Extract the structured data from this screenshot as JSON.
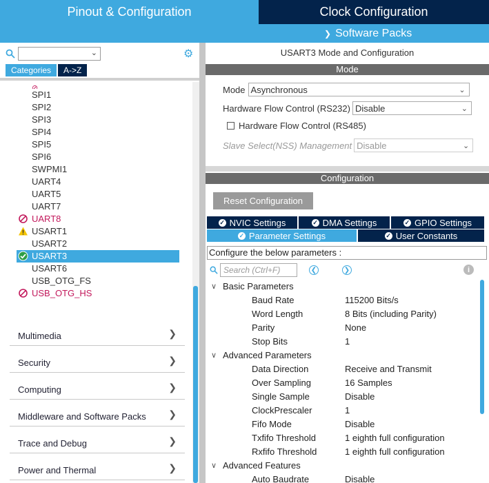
{
  "header": {
    "tab_pinout": "Pinout & Configuration",
    "tab_clock": "Clock Configuration",
    "software_packs": "Software Packs"
  },
  "sidebar": {
    "search_value": "",
    "tab_categories": "Categories",
    "tab_az": "A->Z",
    "peripherals": [
      {
        "label": "SPI1",
        "status": "none"
      },
      {
        "label": "SPI2",
        "status": "none"
      },
      {
        "label": "SPI3",
        "status": "none"
      },
      {
        "label": "SPI4",
        "status": "none"
      },
      {
        "label": "SPI5",
        "status": "none"
      },
      {
        "label": "SPI6",
        "status": "none"
      },
      {
        "label": "SWPMI1",
        "status": "none"
      },
      {
        "label": "UART4",
        "status": "none"
      },
      {
        "label": "UART5",
        "status": "none"
      },
      {
        "label": "UART7",
        "status": "none"
      },
      {
        "label": "UART8",
        "status": "disabled"
      },
      {
        "label": "USART1",
        "status": "warning"
      },
      {
        "label": "USART2",
        "status": "none"
      },
      {
        "label": "USART3",
        "status": "ok"
      },
      {
        "label": "USART6",
        "status": "none"
      },
      {
        "label": "USB_OTG_FS",
        "status": "none"
      },
      {
        "label": "USB_OTG_HS",
        "status": "disabled"
      }
    ],
    "categories": [
      "Multimedia",
      "Security",
      "Computing",
      "Middleware and Software Packs",
      "Trace and Debug",
      "Power and Thermal"
    ]
  },
  "panel": {
    "title": "USART3 Mode and Configuration",
    "mode_header": "Mode",
    "mode_label": "Mode",
    "mode_value": "Asynchronous",
    "hfc232_label": "Hardware Flow Control (RS232)",
    "hfc232_value": "Disable",
    "hfc485_label": "Hardware Flow Control (RS485)",
    "nss_label": "Slave Select(NSS) Management",
    "nss_value": "Disable",
    "config_header": "Configuration",
    "reset_button": "Reset Configuration",
    "tabs": {
      "nvic": "NVIC Settings",
      "dma": "DMA Settings",
      "gpio": "GPIO Settings",
      "params": "Parameter Settings",
      "user_constants": "User Constants"
    },
    "hint": "Configure the below parameters :",
    "search_placeholder": "Search (Ctrl+F)",
    "groups": [
      {
        "label": "Basic Parameters",
        "items": [
          {
            "name": "Baud Rate",
            "value": "115200 Bits/s"
          },
          {
            "name": "Word Length",
            "value": "8 Bits (including Parity)"
          },
          {
            "name": "Parity",
            "value": "None"
          },
          {
            "name": "Stop Bits",
            "value": "1"
          }
        ]
      },
      {
        "label": "Advanced Parameters",
        "items": [
          {
            "name": "Data Direction",
            "value": "Receive and Transmit"
          },
          {
            "name": "Over Sampling",
            "value": "16 Samples"
          },
          {
            "name": "Single Sample",
            "value": "Disable"
          },
          {
            "name": "ClockPrescaler",
            "value": "1"
          },
          {
            "name": "Fifo Mode",
            "value": "Disable"
          },
          {
            "name": "Txfifo Threshold",
            "value": "1 eighth full configuration"
          },
          {
            "name": "Rxfifo Threshold",
            "value": "1 eighth full configuration"
          }
        ]
      },
      {
        "label": "Advanced Features",
        "items": [
          {
            "name": "Auto Baudrate",
            "value": "Disable"
          }
        ]
      }
    ]
  }
}
